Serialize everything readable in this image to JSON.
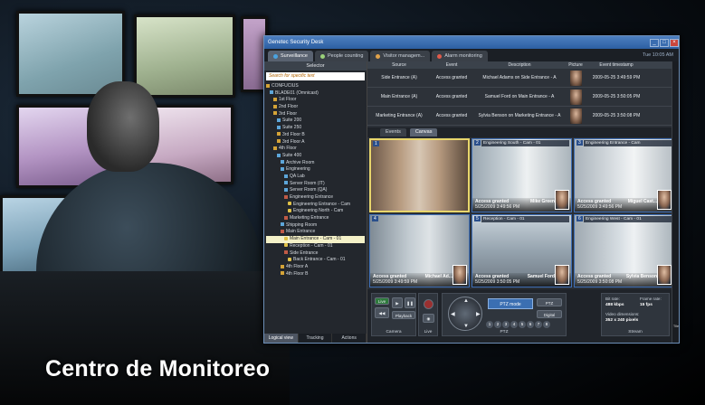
{
  "caption": "Centro de Monitoreo",
  "window": {
    "title": "Genetec Security Desk",
    "controls": [
      "_",
      "□",
      "×"
    ]
  },
  "tabs": [
    {
      "label": "Surveillance",
      "active": true
    },
    {
      "label": "People counting",
      "active": false
    },
    {
      "label": "Visitor managem...",
      "active": false
    },
    {
      "label": "Alarm monitoring",
      "active": false
    }
  ],
  "tab_right_text": "Tue 10:05 AM",
  "selector": {
    "header": "Selector",
    "search_placeholder": "Search for specific text",
    "tree": [
      {
        "label": "CONFUCIUS",
        "icon": "folder-icon"
      },
      {
        "label": "BLADE01 (Omnicast)",
        "icon": "area-icon"
      },
      {
        "label": "1st Floor",
        "icon": "folder-icon"
      },
      {
        "label": "2nd Floor",
        "icon": "folder-icon"
      },
      {
        "label": "3rd Floor",
        "icon": "folder-icon"
      },
      {
        "label": "Suite 200",
        "icon": "area-icon"
      },
      {
        "label": "Suite 250",
        "icon": "area-icon"
      },
      {
        "label": "3rd Floor B",
        "icon": "folder-icon"
      },
      {
        "label": "3rd Floor A",
        "icon": "folder-icon"
      },
      {
        "label": "4th Floor",
        "icon": "folder-icon"
      },
      {
        "label": "Suite 400",
        "icon": "area-icon"
      },
      {
        "label": "Archive Room",
        "icon": "area-icon"
      },
      {
        "label": "Engineering",
        "icon": "area-icon"
      },
      {
        "label": "QA Lab",
        "icon": "area-icon"
      },
      {
        "label": "Server Room (IT)",
        "icon": "area-icon"
      },
      {
        "label": "Server Room (QA)",
        "icon": "area-icon"
      },
      {
        "label": "Engineering Entrance",
        "icon": "door-icon"
      },
      {
        "label": "Engineering Entrance - Cam",
        "icon": "camera-icon"
      },
      {
        "label": "Engineering North - Cam",
        "icon": "camera-icon"
      },
      {
        "label": "Marketing Entrance",
        "icon": "door-icon"
      },
      {
        "label": "Shipping Room",
        "icon": "area-icon"
      },
      {
        "label": "Main Entrance",
        "icon": "door-icon"
      },
      {
        "label": "Main Entrance - Cam - 01",
        "icon": "camera-icon",
        "selected": true
      },
      {
        "label": "Reception - Cam - 01",
        "icon": "camera-icon"
      },
      {
        "label": "Side Entrance",
        "icon": "door-icon"
      },
      {
        "label": "Back Entrance - Cam - 01",
        "icon": "camera-icon"
      },
      {
        "label": "4th Floor A",
        "icon": "folder-icon"
      },
      {
        "label": "4th Floor B",
        "icon": "folder-icon"
      }
    ],
    "bottom_tabs": [
      {
        "label": "Logical view",
        "active": true
      },
      {
        "label": "Tracking",
        "active": false
      },
      {
        "label": "Actions",
        "active": false
      }
    ]
  },
  "events": {
    "columns": [
      "Source",
      "Event",
      "Description",
      "Picture",
      "Event timestamp"
    ],
    "rows": [
      {
        "source": "Side Entrance (A)",
        "event": "Access granted",
        "description": "Michael Adams on Side Entrance - A",
        "timestamp": "2009-05-25 3:49:59 PM"
      },
      {
        "source": "Main Entrance (A)",
        "event": "Access granted",
        "description": "Samuel Ford on Main Entrance - A",
        "timestamp": "2009-05-25 3:50:05 PM"
      },
      {
        "source": "Marketing Entrance (A)",
        "event": "Access granted",
        "description": "Sylvia Benson on Marketing Entrance - A",
        "timestamp": "2009-05-25 3:50:08 PM"
      }
    ]
  },
  "canvas_tabs": [
    {
      "label": "Events",
      "active": false
    },
    {
      "label": "Canvas",
      "active": true
    }
  ],
  "tiles": [
    {
      "num": "1",
      "label": "",
      "status": "",
      "name": "",
      "time": "",
      "selected": true
    },
    {
      "num": "2",
      "label": "Engineering South - Cam - 01",
      "status": "Access granted",
      "name": "Mike Green",
      "time": "5/25/2009 3:49:56 PM",
      "selected": false
    },
    {
      "num": "3",
      "label": "Engineering Entrance - Cam",
      "status": "Access granted",
      "name": "Miguel Cast...",
      "time": "5/25/2009 3:49:56 PM",
      "selected": false
    },
    {
      "num": "4",
      "label": "",
      "status": "Access granted",
      "name": "Michael Ad...",
      "time": "5/25/2009 3:49:59 PM",
      "selected": false
    },
    {
      "num": "5",
      "label": "Reception - Cam - 01",
      "status": "Access granted",
      "name": "Samuel Ford",
      "time": "5/25/2009 3:50:05 PM",
      "selected": false
    },
    {
      "num": "6",
      "label": "Engineering West - Cam - 01",
      "status": "Access granted",
      "name": "Sylvia Benson",
      "time": "5/25/2009 3:50:08 PM",
      "selected": false
    }
  ],
  "controls": {
    "camera_label": "Camera",
    "live_label": "Live",
    "ptz_label": "PTZ",
    "stream_label": "Stream",
    "playback_label": "Playback",
    "live_btn": "Live",
    "ptz_mode": "PTZ mode",
    "ptz_btn": "PTZ",
    "digital_btn": "Digital",
    "presets": [
      "1",
      "2",
      "3",
      "4",
      "5",
      "6",
      "7",
      "8"
    ],
    "bitrate_label": "Bit rate:",
    "bitrate_value": "488 kbps",
    "framerate_label": "Frame rate:",
    "framerate_value": "15 fps",
    "resolution_label": "Video dimensions:",
    "resolution_value": "352 x 240 pixels"
  },
  "side_strip_label": "Tile"
}
